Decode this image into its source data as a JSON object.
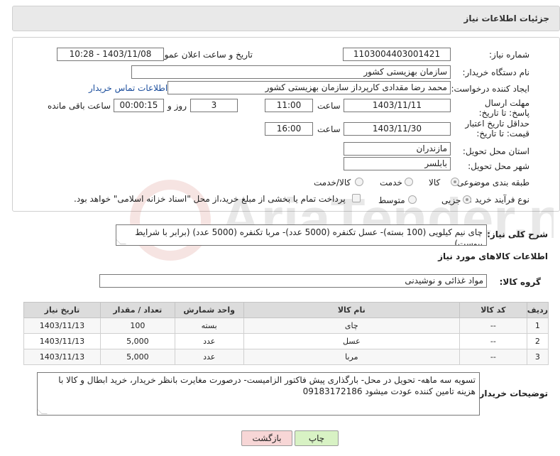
{
  "header": {
    "title": "جزئیات اطلاعات نیاز"
  },
  "fields": {
    "need_number": {
      "label": "شماره نیاز:",
      "value": "1103004403001421"
    },
    "announce": {
      "label": "تاریخ و ساعت اعلان عمومی:",
      "value": "1403/11/08 - 10:28"
    },
    "buyer_org": {
      "label": "نام دستگاه خریدار:",
      "value": "سازمان بهزیستی کشور"
    },
    "creator": {
      "label": "ایجاد کننده درخواست:",
      "value": "محمد رضا  مقدادی کارپرداز سازمان بهزیستی کشور",
      "contact_link": "اطلاعات تماس خریدار"
    },
    "send_deadline": {
      "label": "مهلت ارسال پاسخ: تا تاریخ:",
      "date": "1403/11/11",
      "time_label": "ساعت",
      "time": "11:00",
      "days": "3",
      "days_label": "روز و",
      "remaining": "00:00:15",
      "remaining_label": "ساعت باقی مانده"
    },
    "price_validity": {
      "label": "حداقل تاریخ اعتبار قیمت: تا تاریخ:",
      "date": "1403/11/30",
      "time_label": "ساعت",
      "time": "16:00"
    },
    "province": {
      "label": "استان محل تحویل:",
      "value": "مازندران"
    },
    "city": {
      "label": "شهر محل تحویل:",
      "value": "بابلسر"
    },
    "category": {
      "label": "طبقه بندی موضوعی:",
      "options": [
        "کالا",
        "خدمت",
        "کالا/خدمت"
      ],
      "selected": "کالا"
    },
    "process": {
      "label": "نوع فرآیند خرید :",
      "options": [
        "جزیی",
        "متوسط"
      ],
      "selected": "جزیی",
      "note": "پرداخت تمام یا بخشی از مبلغ خرید،از محل \"اسناد خزانه اسلامی\" خواهد بود."
    }
  },
  "description": {
    "label": "شرح کلی نیاز:",
    "value": "چای نیم کیلویی (100 بسته)- عسل تکنفره (5000 عدد)- مربا تکنفره (5000 عدد) (برابر با شرایط پیوست)"
  },
  "goods": {
    "section_title": "اطلاعات کالاهای مورد نیاز",
    "group_label": "گروه کالا:",
    "group_value": "مواد غذائی و نوشیدنی",
    "columns": [
      "ردیف",
      "کد کالا",
      "نام کالا",
      "واحد شمارش",
      "تعداد / مقدار",
      "تاریخ نیاز"
    ],
    "rows": [
      [
        "1",
        "--",
        "چای",
        "بسته",
        "100",
        "1403/11/13"
      ],
      [
        "2",
        "--",
        "عسل",
        "عدد",
        "5,000",
        "1403/11/13"
      ],
      [
        "3",
        "--",
        "مربا",
        "عدد",
        "5,000",
        "1403/11/13"
      ]
    ]
  },
  "buyer_notes": {
    "label": "توضیحات خریدار:",
    "value": "تسویه سه ماهه- تحویل در محل- بارگذاری پیش فاکتور الزامیست- درصورت مغایرت بانظر خریدار، خرید ابطال و کالا با هزینه تامین کننده عودت میشود 09183172186"
  },
  "buttons": {
    "print": "چاپ",
    "back": "بازگشت"
  },
  "watermark_text": "AriaTender.net"
}
